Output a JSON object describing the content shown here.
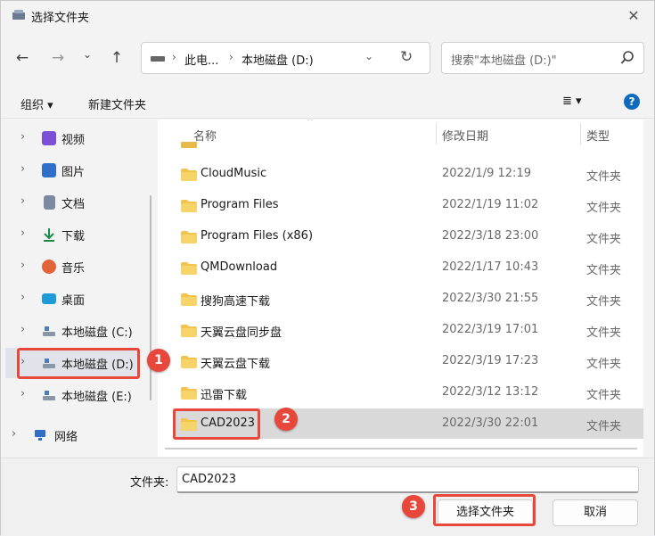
{
  "window": {
    "title": "选择文件夹",
    "close_glyph": "✕"
  },
  "nav": {
    "back_glyph": "←",
    "forward_glyph": "→",
    "recent_glyph": "⌄",
    "up_glyph": "↑",
    "address": {
      "crumb_pc": "此电...",
      "crumb_drive": "本地磁盘 (D:)",
      "sep_glyph": "›",
      "dropdown_glyph": "⌄",
      "refresh_glyph": "↻"
    },
    "search_placeholder": "搜索\"本地磁盘 (D:)\""
  },
  "toolbar": {
    "organize": "组织 ▾",
    "new_folder": "新建文件夹",
    "view_glyph": "≣ ▾",
    "help": "?"
  },
  "sidebar": {
    "items": [
      {
        "label": "视频",
        "icon": "video-icon",
        "color": "#7b4fd6"
      },
      {
        "label": "图片",
        "icon": "pictures-icon",
        "color": "#2f6fc7"
      },
      {
        "label": "文档",
        "icon": "documents-icon",
        "color": "#7b8aa0"
      },
      {
        "label": "下载",
        "icon": "download-icon",
        "color": "#1b8a4a"
      },
      {
        "label": "音乐",
        "icon": "music-icon",
        "color": "#e0633a"
      },
      {
        "label": "桌面",
        "icon": "desktop-icon",
        "color": "#1e9ad6"
      },
      {
        "label": "本地磁盘 (C:)",
        "icon": "drive-icon",
        "color": "#4a7fb5"
      },
      {
        "label": "本地磁盘 (D:)",
        "icon": "drive-icon",
        "color": "#4a7fb5"
      },
      {
        "label": "本地磁盘 (E:)",
        "icon": "drive-icon",
        "color": "#4a7fb5"
      },
      {
        "label": "网络",
        "icon": "network-icon",
        "color": "#2f6fc7"
      }
    ],
    "chevron_glyph": "›"
  },
  "filelist": {
    "columns": {
      "name": "名称",
      "date": "修改日期",
      "type": "类型"
    },
    "rows": [
      {
        "name": "CloudMusic",
        "date": "2022/1/9 12:19",
        "type": "文件夹"
      },
      {
        "name": "Program Files",
        "date": "2022/1/19 11:02",
        "type": "文件夹"
      },
      {
        "name": "Program Files (x86)",
        "date": "2022/3/18 23:00",
        "type": "文件夹"
      },
      {
        "name": "QMDownload",
        "date": "2022/1/17 10:43",
        "type": "文件夹"
      },
      {
        "name": "搜狗高速下载",
        "date": "2022/3/30 21:55",
        "type": "文件夹"
      },
      {
        "name": "天翼云盘同步盘",
        "date": "2022/3/19 17:01",
        "type": "文件夹"
      },
      {
        "name": "天翼云盘下载",
        "date": "2022/3/19 17:23",
        "type": "文件夹"
      },
      {
        "name": "迅雷下载",
        "date": "2022/3/12 13:12",
        "type": "文件夹"
      },
      {
        "name": "CAD2023",
        "date": "2022/3/30 22:01",
        "type": "文件夹"
      }
    ]
  },
  "bottom": {
    "folder_label": "文件夹:",
    "folder_value": "CAD2023",
    "select_button": "选择文件夹",
    "cancel_button": "取消"
  },
  "annotations": {
    "badge1": "1",
    "badge2": "2",
    "badge3": "3",
    "color": "#e8473b"
  }
}
